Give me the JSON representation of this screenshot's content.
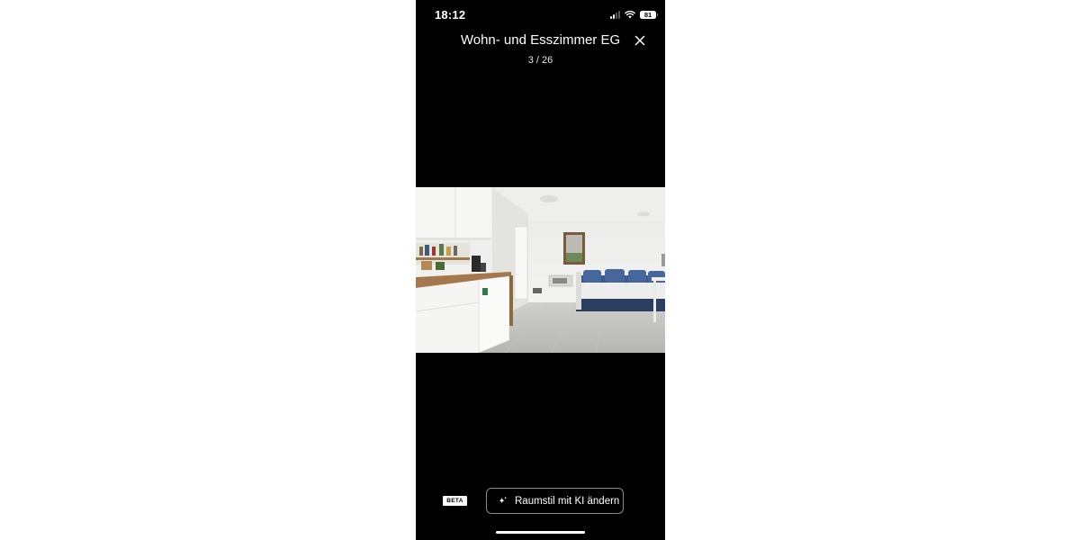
{
  "status_bar": {
    "time": "18:12",
    "battery": "81",
    "icons": [
      "signal-icon",
      "wifi-icon",
      "battery-icon"
    ]
  },
  "header": {
    "title": "Wohn- und Esszimmer EG",
    "counter": "3 / 26",
    "close_icon": "close-icon"
  },
  "photo": {
    "subject": "room-photo"
  },
  "bottom": {
    "beta_badge": "BETA",
    "ki_button_label": "Raumstil mit KI ändern",
    "ki_button_icon": "sparkle-icon"
  },
  "colors": {
    "background": "#000000",
    "text": "#ffffff",
    "button_border": "#8a8a8a"
  }
}
